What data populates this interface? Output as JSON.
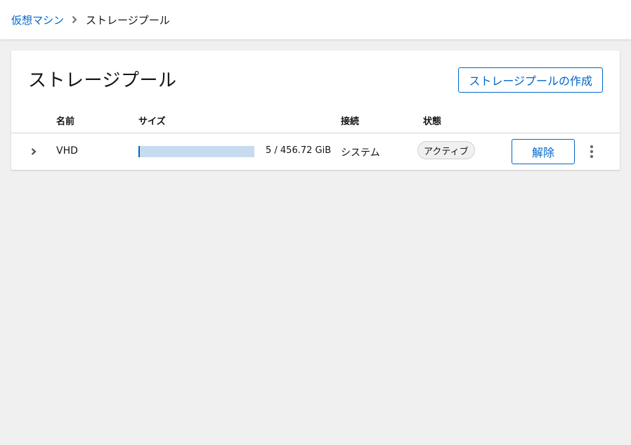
{
  "breadcrumb": {
    "parent": "仮想マシン",
    "current": "ストレージプール"
  },
  "page": {
    "title": "ストレージプール",
    "create_button": "ストレージプールの作成"
  },
  "table": {
    "columns": [
      "名前",
      "サイズ",
      "接続",
      "状態"
    ],
    "rows": [
      {
        "name": "VHD",
        "size_text": "5 / 456.72 GiB",
        "usage_fraction": 0.011,
        "connection": "システム",
        "status": "アクティブ",
        "action_label": "解除"
      }
    ]
  },
  "colors": {
    "accent": "#0066cc",
    "progress_track": "#c7dbee",
    "background": "#f0f0f0"
  },
  "icons": {
    "breadcrumb_separator": "chevron-right-icon",
    "row_expand": "chevron-right-icon",
    "row_menu": "kebab-menu-icon"
  }
}
